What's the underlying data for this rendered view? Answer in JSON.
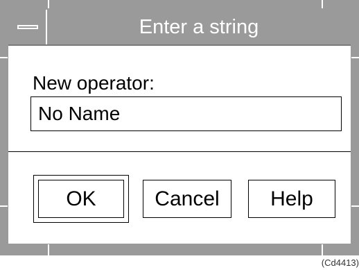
{
  "window": {
    "title": "Enter a string",
    "system_menu_icon": "system-menu-icon"
  },
  "form": {
    "label": "New operator:",
    "value": "No Name"
  },
  "buttons": {
    "ok": "OK",
    "cancel": "Cancel",
    "help": "Help"
  },
  "figure_caption": "(Cd4413)",
  "colors": {
    "frame": "#9a9a9a",
    "title_text": "#ffffff",
    "client": "#ffffff"
  }
}
